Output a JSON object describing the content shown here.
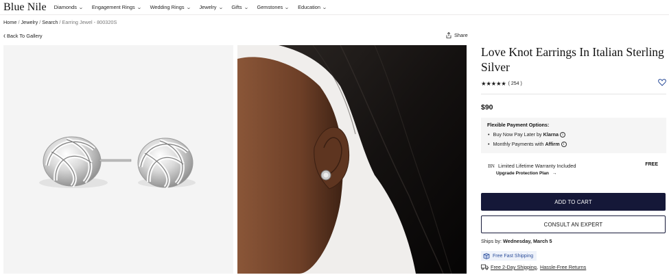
{
  "brand": "Blue Nile",
  "nav": {
    "items": [
      "Diamonds",
      "Engagement Rings",
      "Wedding Rings",
      "Jewelry",
      "Gifts",
      "Gemstones",
      "Education"
    ]
  },
  "breadcrumb": {
    "home": "Home",
    "jewelry": "Jewelry",
    "search": "Search",
    "current": "Earring Jewel - 800320S",
    "sep": "/"
  },
  "back_label": "Back To Gallery",
  "share_label": "Share",
  "product": {
    "title": "Love Knot Earrings In Italian Sterling Silver",
    "stars": "★★★★★",
    "reviews": "( 254 )",
    "price": "$90"
  },
  "payment": {
    "heading": "Flexible Payment Options:",
    "line1_prefix": "Buy Now Pay Later by",
    "line1_brand": "Klarna",
    "line2_prefix": "Monthly Payments with",
    "line2_brand": "Affirm",
    "info_glyph": "i"
  },
  "warranty": {
    "mark": "BN",
    "text": "Limited Lifetime Warranty Included",
    "free": "FREE",
    "upgrade": "Upgrade Protection Plan",
    "arrow": "→"
  },
  "buttons": {
    "cart": "ADD TO CART",
    "expert": "CONSULT AN EXPERT"
  },
  "shipping": {
    "ships_by_label": "Ships by:",
    "ships_by_date": "Wednesday, March 5",
    "free_fast": "Free Fast Shipping",
    "two_day": "Free 2-Day Shipping",
    "sep": ",",
    "returns": "Hassle-Free Returns"
  },
  "colors": {
    "primary_button": "#151838",
    "shipping_blue": "#2c4e9a"
  }
}
